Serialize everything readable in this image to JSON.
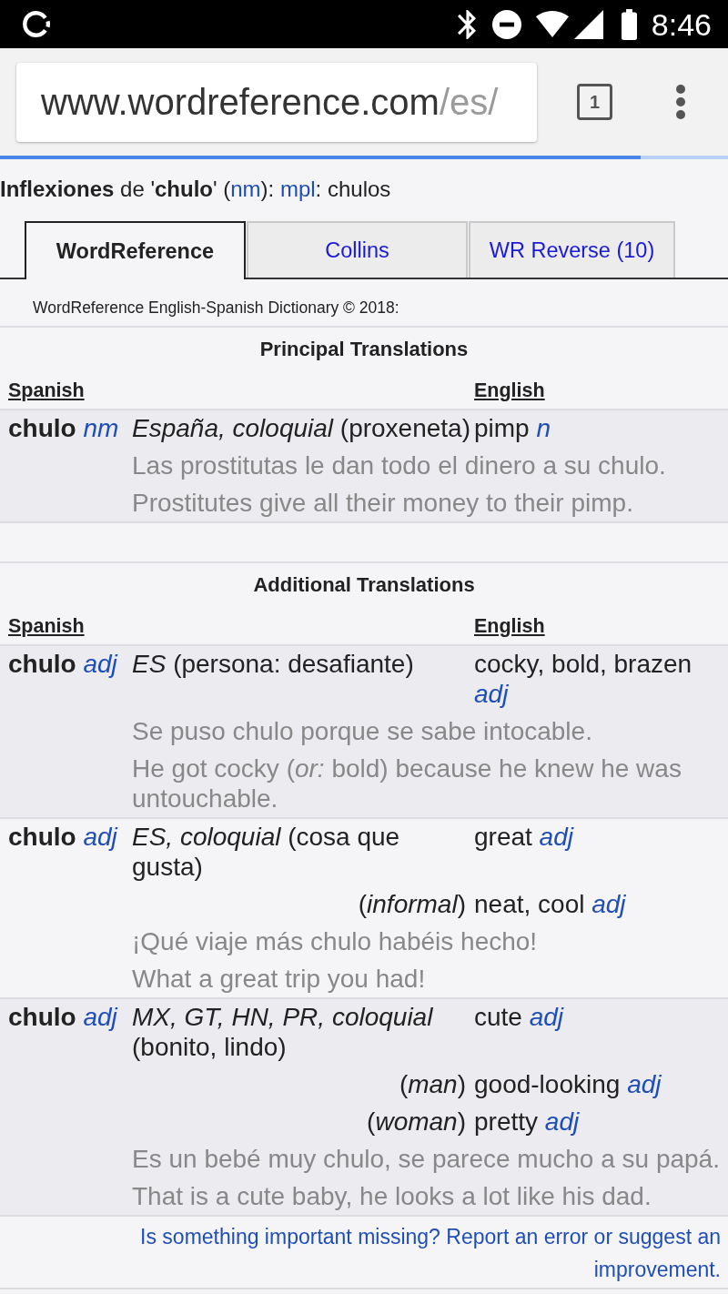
{
  "status_bar": {
    "time": "8:46"
  },
  "browser": {
    "url": {
      "host": "www.wordreference.com",
      "path": "/es/"
    },
    "tab_count": "1",
    "progress": {
      "level": 0.88
    }
  },
  "inflections": [
    {
      "parts": [
        {
          "kind": "text",
          "text": "**Inflexiones** de '**chulo**' ("
        },
        {
          "kind": "link",
          "text": "nm"
        },
        {
          "kind": "text",
          "text": "): "
        },
        {
          "kind": "link",
          "text": "mpl"
        },
        {
          "kind": "text",
          "text": ": chulos"
        }
      ]
    }
  ],
  "tabs": [
    {
      "label": "WordReference",
      "selected": true
    },
    {
      "label": "Collins",
      "selected": false
    },
    {
      "label": "WR Reverse (10)",
      "selected": false
    }
  ],
  "copyright": "WordReference English-Spanish Dictionary © 2018:",
  "sections": [
    {
      "title": "Principal Translations",
      "columns": [
        "Spanish",
        "English"
      ],
      "entries": [
        {
          "term": "chulo",
          "pos": "nm",
          "sense": "*España, coloquial* (proxeneta)",
          "translations": [
            {
              "text": "pimp",
              "pos": "n"
            }
          ],
          "examples": [
            "Las prostitutas le dan todo el dinero a su chulo.",
            "Prostitutes give all their money to their pimp."
          ]
        }
      ]
    },
    {
      "title": "Additional Translations",
      "columns": [
        "Spanish",
        "English"
      ],
      "entries": [
        {
          "term": "chulo",
          "pos": "adj",
          "sense": "*ES* (persona: desafiante)",
          "translations": [
            {
              "text": "cocky, bold, brazen",
              "pos": "adj"
            }
          ],
          "examples": [
            "Se puso chulo porque se sabe intocable.",
            "He got cocky (*or:* bold) because he knew he was untouchable."
          ]
        },
        {
          "term": "chulo",
          "pos": "adj",
          "sense": "*ES, coloquial* (cosa que gusta)",
          "translations": [
            {
              "text": "great",
              "pos": "adj"
            },
            {
              "note": "(*informal*)",
              "text": "neat, cool",
              "pos": "adj"
            }
          ],
          "examples": [
            "¡Qué viaje más chulo habéis hecho!",
            "What a great trip you had!"
          ]
        },
        {
          "term": "chulo",
          "pos": "adj",
          "sense": "*MX, GT, HN, PR, coloquial* (bonito, lindo)",
          "translations": [
            {
              "text": "cute",
              "pos": "adj"
            },
            {
              "note": "(*man*)",
              "text": "good-looking",
              "pos": "adj"
            },
            {
              "note": "(*woman*)",
              "text": "pretty",
              "pos": "adj"
            }
          ],
          "examples": [
            "Es un bebé muy chulo, se parece mucho a su papá.",
            "That is a cute baby, he looks a lot like his dad."
          ]
        }
      ]
    }
  ],
  "report_link": "Is something important missing? Report an error or suggest an improvement."
}
